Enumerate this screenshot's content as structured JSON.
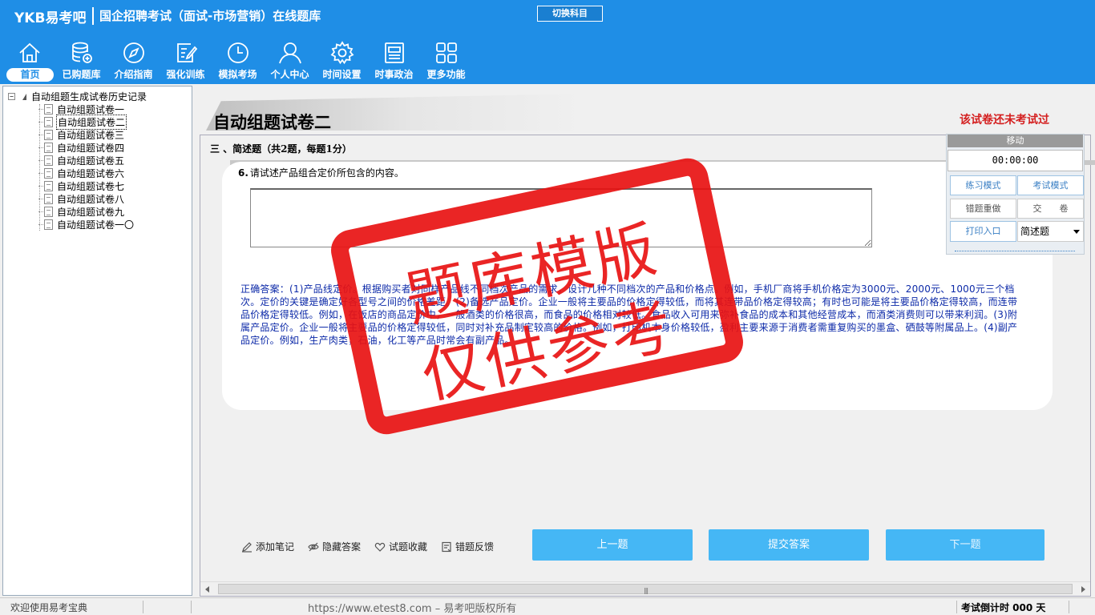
{
  "header": {
    "logo": "YKB易考吧",
    "title": "国企招聘考试（面试-市场营销）在线题库",
    "switch_subject": "切换科目"
  },
  "nav": {
    "items": [
      {
        "label": "首页",
        "icon": "home-icon",
        "active": true
      },
      {
        "label": "已购题库",
        "icon": "database-icon"
      },
      {
        "label": "介绍指南",
        "icon": "compass-icon"
      },
      {
        "label": "强化训练",
        "icon": "edit-icon"
      },
      {
        "label": "模拟考场",
        "icon": "clock-icon"
      },
      {
        "label": "个人中心",
        "icon": "user-icon"
      },
      {
        "label": "时间设置",
        "icon": "gear-icon"
      },
      {
        "label": "时事政治",
        "icon": "news-icon"
      },
      {
        "label": "更多功能",
        "icon": "grid-icon"
      }
    ]
  },
  "tree": {
    "root": "自动组题生成试卷历史记录",
    "items": [
      "自动组题试卷一",
      "自动组题试卷二",
      "自动组题试卷三",
      "自动组题试卷四",
      "自动组题试卷五",
      "自动组题试卷六",
      "自动组题试卷七",
      "自动组题试卷八",
      "自动组题试卷九",
      "自动组题试卷一〇"
    ],
    "selected_index": 1
  },
  "paper": {
    "title": "自动组题试卷二",
    "status": "该试卷还未考试过",
    "section": "三 、简述题（共2题，每题1分）",
    "question_number": "6.",
    "question_text": "请试述产品组合定价所包含的内容。",
    "answer": "正确答案：(1)产品线定价。根据购买者对同样产品线不同档次产品的需求，设计几种不同档次的产品和价格点。例如，手机厂商将手机价格定为3000元、2000元、1000元三个档次。定价的关键是确定好各型号之间的价格差距。(2)备选产品定价。企业一般将主要品的价格定得较低，而将其连带品价格定得较高；有时也可能是将主要品价格定得较高，而连带品价格定得较低。例如，在饭店的商品定价中，一般酒类的价格很高，而食品的价格相对较低。食品收入可用来弥补食品的成本和其他经营成本，而酒类消费则可以带来利润。(3)附属产品定价。企业一般将主要品的价格定得较低，同时对补充品制定较高的价格。例如，打印机本身价格较低，盈利主要来源于消费者需重复购买的墨盒、硒鼓等附属品上。(4)副产品定价。例如，生产肉类，石油，化工等产品时常会有副产品。"
  },
  "float_panel": {
    "move": "移动",
    "timer": "00:00:00",
    "practice_mode": "练习模式",
    "exam_mode": "考试模式",
    "redo_wrong": "错题重做",
    "submit_paper": "交　　卷",
    "print": "打印入口",
    "question_type": "简述题"
  },
  "tools": {
    "add_note": "添加笔记",
    "hide_answer": "隐藏答案",
    "favorite": "试题收藏",
    "feedback": "错题反馈"
  },
  "buttons": {
    "prev": "上一题",
    "submit": "提交答案",
    "next": "下一题"
  },
  "status_bar": {
    "welcome": "欢迎使用易考宝典",
    "url": "https://www.etest8.com – 易考吧版权所有",
    "countdown": "考试倒计时 000 天"
  },
  "watermark": {
    "line1": "题库模版",
    "line2": "仅供参考"
  },
  "colors": {
    "header_blue": "#1f8ee6",
    "button_blue": "#45b7f5",
    "answer_text": "#0d2aa8",
    "status_red": "#d41f1f",
    "stamp_red": "#e81212"
  }
}
